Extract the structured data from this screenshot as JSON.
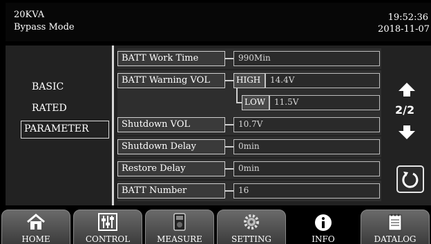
{
  "header": {
    "model": "20KVA",
    "mode": "Bypass Mode",
    "time": "19:52:36",
    "date": "2018-11-07"
  },
  "menu": {
    "basic": "BASIC",
    "rated": "RATED",
    "parameter": "PARAMETER",
    "selected": "PARAMETER"
  },
  "params": {
    "batt_work_time": {
      "label": "BATT Work Time",
      "value": "990Min"
    },
    "batt_warning_vol": {
      "label": "BATT Warning VOL",
      "high_label": "HIGH",
      "high_value": "14.4V",
      "low_label": "LOW",
      "low_value": "11.5V"
    },
    "shutdown_vol": {
      "label": "Shutdown VOL",
      "value": "10.7V"
    },
    "shutdown_delay": {
      "label": "Shutdown Delay",
      "value": "0min"
    },
    "restore_delay": {
      "label": "Restore Delay",
      "value": "0min"
    },
    "batt_number": {
      "label": "BATT Number",
      "value": "16"
    }
  },
  "pager": {
    "page": "2/2"
  },
  "nav": {
    "tabs": [
      "HOME",
      "CONTROL",
      "MEASURE",
      "SETTING",
      "INFO",
      "DATALOG"
    ],
    "active": "INFO"
  },
  "icons": {
    "up": "arrow-up-icon",
    "down": "arrow-down-icon",
    "refresh": "refresh-icon",
    "home": "home-icon",
    "control": "sliders-icon",
    "measure": "meter-icon",
    "setting": "gear-icon",
    "info": "info-icon",
    "datalog": "notepad-icon"
  },
  "colors": {
    "background": "#000000",
    "panel": "#222222",
    "tab": "#5a5a5a"
  }
}
